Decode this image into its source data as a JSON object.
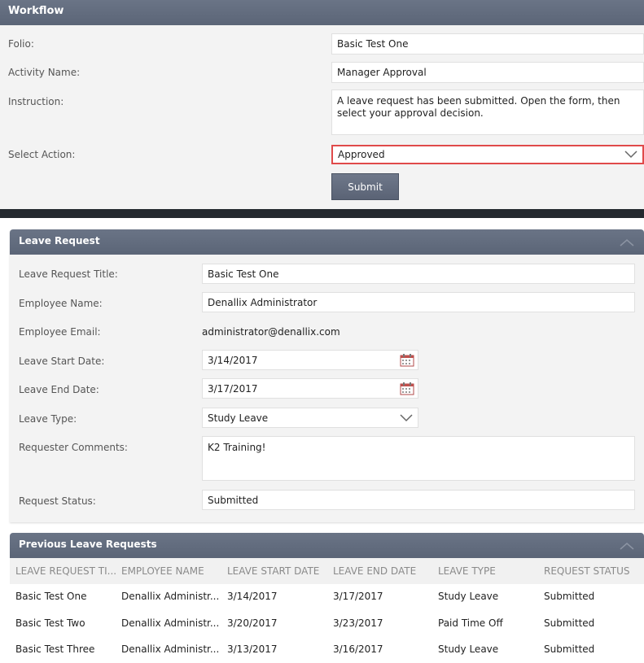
{
  "workflow": {
    "title": "Workflow",
    "folio_label": "Folio:",
    "folio_value": "Basic Test One",
    "activity_label": "Activity Name:",
    "activity_value": "Manager Approval",
    "instruction_label": "Instruction:",
    "instruction_value": "A leave request has been submitted. Open the form, then select your approval decision.",
    "action_label": "Select Action:",
    "action_value": "Approved",
    "submit_label": "Submit",
    "highlight_color": "#e04a4a"
  },
  "leave_request": {
    "title": "Leave Request",
    "collapse_icon": "chevron-up-icon",
    "fields": {
      "title_label": "Leave Request Title:",
      "title_value": "Basic Test One",
      "employee_label": "Employee Name:",
      "employee_value": "Denallix Administrator",
      "email_label": "Employee Email:",
      "email_value": "administrator@denallix.com",
      "start_label": "Leave Start Date:",
      "start_value": "3/14/2017",
      "end_label": "Leave End Date:",
      "end_value": "3/17/2017",
      "type_label": "Leave Type:",
      "type_value": "Study Leave",
      "comments_label": "Requester Comments:",
      "comments_value": "K2 Training!",
      "status_label": "Request Status:",
      "status_value": "Submitted"
    }
  },
  "previous_requests": {
    "title": "Previous Leave Requests",
    "columns": [
      "LEAVE REQUEST TI...",
      "EMPLOYEE NAME",
      "LEAVE START DATE",
      "LEAVE END DATE",
      "LEAVE TYPE",
      "REQUEST STATUS"
    ],
    "rows": [
      [
        "Basic Test One",
        "Denallix Administr...",
        "3/14/2017",
        "3/17/2017",
        "Study Leave",
        "Submitted"
      ],
      [
        "Basic Test Two",
        "Denallix Administr...",
        "3/20/2017",
        "3/23/2017",
        "Paid Time Off",
        "Submitted"
      ],
      [
        "Basic Test Three",
        "Denallix Administr...",
        "3/13/2017",
        "3/16/2017",
        "Study Leave",
        "Submitted"
      ]
    ]
  }
}
